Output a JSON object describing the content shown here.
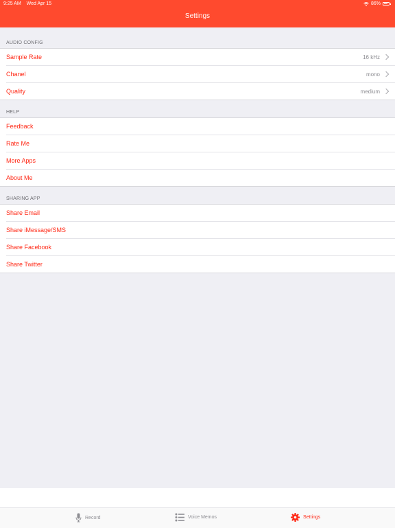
{
  "status": {
    "time": "9:25 AM",
    "date": "Wed Apr 15",
    "battery": "86%",
    "battery_level": 0.86
  },
  "nav": {
    "title": "Settings"
  },
  "sections": [
    {
      "header": "AUDIO CONFIG",
      "rows": [
        {
          "label": "Sample Rate",
          "value": "16 kHz"
        },
        {
          "label": "Chanel",
          "value": "mono"
        },
        {
          "label": "Quality",
          "value": "medium"
        }
      ]
    },
    {
      "header": "HELP",
      "rows": [
        {
          "label": "Feedback"
        },
        {
          "label": "Rate Me"
        },
        {
          "label": "More Apps"
        },
        {
          "label": "About Me"
        }
      ]
    },
    {
      "header": "SHARING APP",
      "rows": [
        {
          "label": "Share Email"
        },
        {
          "label": "Share iMessage/SMS"
        },
        {
          "label": "Share Facebook"
        },
        {
          "label": "Share Twitter"
        }
      ]
    }
  ],
  "tabbar": {
    "record": {
      "label": "Record",
      "icon": "microphone-icon"
    },
    "memos": {
      "label": "Voice Memos",
      "icon": "list-icon"
    },
    "settings": {
      "label": "Settings",
      "icon": "gear-icon",
      "active": true
    }
  },
  "colors": {
    "accent": "#ff2a17",
    "header": "#ff4a2e",
    "background": "#efeff4",
    "secondary_text": "#8e8e93"
  }
}
